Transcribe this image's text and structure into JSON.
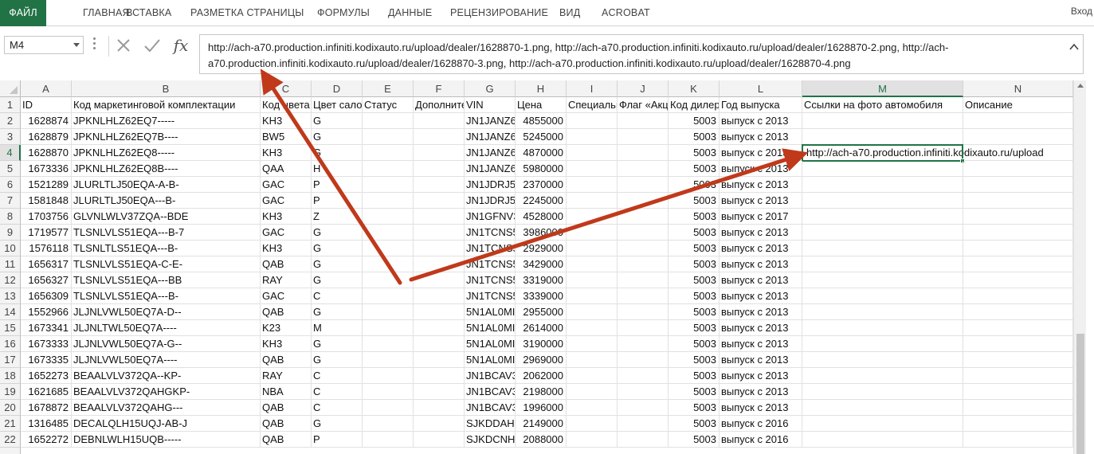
{
  "ribbon": {
    "tabs": [
      "ФАЙЛ",
      "ГЛАВНАЯ",
      "ВСТАВКА",
      "РАЗМЕТКА СТРАНИЦЫ",
      "ФОРМУЛЫ",
      "ДАННЫЕ",
      "РЕЦЕНЗИРОВАНИЕ",
      "ВИД",
      "ACROBAT"
    ],
    "signin": "Вход"
  },
  "formula_bar": {
    "name_box": "M4",
    "fx_label": "fx",
    "formula": "http://ach-a70.production.infiniti.kodixauto.ru/upload/dealer/1628870-1.png, http://ach-a70.production.infiniti.kodixauto.ru/upload/dealer/1628870-2.png, http://ach-a70.production.infiniti.kodixauto.ru/upload/dealer/1628870-3.png, http://ach-a70.production.infiniti.kodixauto.ru/upload/dealer/1628870-4.png"
  },
  "sheet": {
    "columns": [
      "A",
      "B",
      "C",
      "D",
      "E",
      "F",
      "G",
      "H",
      "I",
      "J",
      "K",
      "L",
      "M",
      "N"
    ],
    "selected_column": "M",
    "selected_row": "4",
    "header_row": [
      "ID",
      "Код маркетинговой комплектации",
      "Код цвета",
      "Цвет салона",
      "Статус",
      "Дополнительно",
      "VIN",
      "Цена",
      "Специальная",
      "Флаг «Акция»",
      "Код дилера",
      "Год выпуска",
      "Ссылки на фото автомобиля",
      "Описание"
    ],
    "rows": [
      {
        "n": "2",
        "A": "1628874",
        "B": "JPKNLHLZ62EQ7-----",
        "C": "KH3",
        "D": "G",
        "G": "JN1JANZ6",
        "H": "4855000",
        "K": "5003",
        "L": "выпуск с 2013",
        "M": ""
      },
      {
        "n": "3",
        "A": "1628879",
        "B": "JPKNLHLZ62EQ7B----",
        "C": "BW5",
        "D": "G",
        "G": "JN1JANZ6",
        "H": "5245000",
        "K": "5003",
        "L": "выпуск с 2013",
        "M": ""
      },
      {
        "n": "4",
        "A": "1628870",
        "B": "JPKNLHLZ62EQ8-----",
        "C": "KH3",
        "D": "G",
        "G": "JN1JANZ6",
        "H": "4870000",
        "K": "5003",
        "L": "выпуск с 2013",
        "M": "http://ach-a70.production.infiniti.kodixauto.ru/upload"
      },
      {
        "n": "5",
        "A": "1673336",
        "B": "JPKNLHLZ62EQ8B----",
        "C": "QAA",
        "D": "H",
        "G": "JN1JANZ6",
        "H": "5980000",
        "K": "5003",
        "L": "выпуск с 2013",
        "M": ""
      },
      {
        "n": "6",
        "A": "1521289",
        "B": "JLURLTLJ50EQA-A-B-",
        "C": "GAC",
        "D": "P",
        "G": "JN1JDRJ5",
        "H": "2370000",
        "K": "5003",
        "L": "выпуск с 2013",
        "M": ""
      },
      {
        "n": "7",
        "A": "1581848",
        "B": "JLURLTLJ50EQA---B-",
        "C": "GAC",
        "D": "P",
        "G": "JN1JDRJ5",
        "H": "2245000",
        "K": "5003",
        "L": "выпуск с 2013",
        "M": ""
      },
      {
        "n": "8",
        "A": "1703756",
        "B": "GLVNLWLV37ZQA--BDE",
        "C": "KH3",
        "D": "Z",
        "G": "JN1GFNV3",
        "H": "4528000",
        "K": "5003",
        "L": "выпуск с 2017",
        "M": ""
      },
      {
        "n": "9",
        "A": "1719577",
        "B": "TLSNLVLS51EQA---B-7",
        "C": "GAC",
        "D": "G",
        "G": "JN1TCNS5",
        "H": "3986000",
        "K": "5003",
        "L": "выпуск с 2013",
        "M": ""
      },
      {
        "n": "10",
        "A": "1576118",
        "B": "TLSNLTLS51EQA---B-",
        "C": "KH3",
        "D": "G",
        "G": "JN1TCNS5",
        "H": "2929000",
        "K": "5003",
        "L": "выпуск с 2013",
        "M": ""
      },
      {
        "n": "11",
        "A": "1656317",
        "B": "TLSNLVLS51EQA-C-E-",
        "C": "QAB",
        "D": "G",
        "G": "JN1TCNS5",
        "H": "3429000",
        "K": "5003",
        "L": "выпуск с 2013",
        "M": ""
      },
      {
        "n": "12",
        "A": "1656327",
        "B": "TLSNLVLS51EQA---BB",
        "C": "RAY",
        "D": "G",
        "G": "JN1TCNS5",
        "H": "3319000",
        "K": "5003",
        "L": "выпуск с 2013",
        "M": ""
      },
      {
        "n": "13",
        "A": "1656309",
        "B": "TLSNLVLS51EQA---B-",
        "C": "GAC",
        "D": "C",
        "G": "JN1TCNS5",
        "H": "3339000",
        "K": "5003",
        "L": "выпуск с 2013",
        "M": ""
      },
      {
        "n": "14",
        "A": "1552966",
        "B": "JLJNLVWL50EQ7A-D--",
        "C": "QAB",
        "D": "G",
        "G": "5N1AL0MI",
        "H": "2955000",
        "K": "5003",
        "L": "выпуск с 2013",
        "M": ""
      },
      {
        "n": "15",
        "A": "1673341",
        "B": "JLJNLTWL50EQ7A----",
        "C": "K23",
        "D": "M",
        "G": "5N1AL0MI",
        "H": "2614000",
        "K": "5003",
        "L": "выпуск с 2013",
        "M": ""
      },
      {
        "n": "16",
        "A": "1673333",
        "B": "JLJNLVWL50EQ7A-G--",
        "C": "KH3",
        "D": "G",
        "G": "5N1AL0MI",
        "H": "3190000",
        "K": "5003",
        "L": "выпуск с 2013",
        "M": ""
      },
      {
        "n": "17",
        "A": "1673335",
        "B": "JLJNLVWL50EQ7A----",
        "C": "QAB",
        "D": "G",
        "G": "5N1AL0MI",
        "H": "2969000",
        "K": "5003",
        "L": "выпуск с 2013",
        "M": ""
      },
      {
        "n": "18",
        "A": "1652273",
        "B": "BEAALVLV372QA--KP-",
        "C": "RAY",
        "D": "C",
        "G": "JN1BCAV3",
        "H": "2062000",
        "K": "5003",
        "L": "выпуск с 2013",
        "M": ""
      },
      {
        "n": "19",
        "A": "1621685",
        "B": "BEAALVLV372QAHGKP-",
        "C": "NBA",
        "D": "C",
        "G": "JN1BCAV3",
        "H": "2198000",
        "K": "5003",
        "L": "выпуск с 2013",
        "M": ""
      },
      {
        "n": "20",
        "A": "1678872",
        "B": "BEAALVLV372QAHG---",
        "C": "QAB",
        "D": "C",
        "G": "JN1BCAV3",
        "H": "1996000",
        "K": "5003",
        "L": "выпуск с 2013",
        "M": ""
      },
      {
        "n": "21",
        "A": "1316485",
        "B": "DECALQLH15UQJ-AB-J",
        "C": "QAB",
        "D": "G",
        "G": "SJKDDAH1",
        "H": "2149000",
        "K": "5003",
        "L": "выпуск с 2016",
        "M": ""
      },
      {
        "n": "22",
        "A": "1652272",
        "B": "DEBNLWLH15UQB-----",
        "C": "QAB",
        "D": "P",
        "G": "SJKDCNH1",
        "H": "2088000",
        "K": "5003",
        "L": "выпуск с 2016",
        "M": ""
      }
    ]
  },
  "colors": {
    "accent": "#217346",
    "arrow": "#c0391b"
  }
}
